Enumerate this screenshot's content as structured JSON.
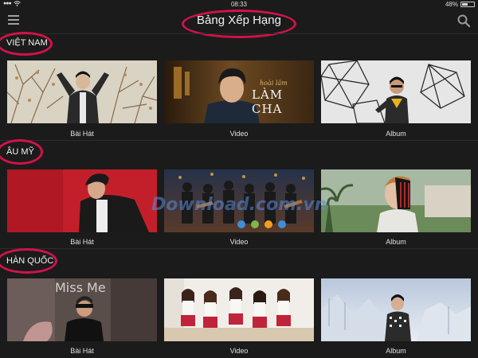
{
  "status": {
    "time": "08:33",
    "battery": "48%"
  },
  "header": {
    "title": "Bảng Xếp Hạng"
  },
  "sections": [
    {
      "label": "VIỆT NAM",
      "items": [
        {
          "caption": "Bài Hát"
        },
        {
          "caption": "Video"
        },
        {
          "caption": "Album"
        }
      ]
    },
    {
      "label": "ÂU MỸ",
      "items": [
        {
          "caption": "Bài Hát"
        },
        {
          "caption": "Video"
        },
        {
          "caption": "Album"
        }
      ]
    },
    {
      "label": "HÀN QUỐC",
      "items": [
        {
          "caption": "Bài Hát"
        },
        {
          "caption": "Video"
        },
        {
          "caption": "Album"
        }
      ]
    }
  ],
  "thumbnail_text": {
    "vn_video_small": "hoài lâm",
    "vn_video_big": "LÀM CHA",
    "kr_song": "Miss Me"
  },
  "watermark": "Download.com.vn",
  "icons": {
    "menu": "hamburger-menu-icon",
    "search": "search-icon",
    "wifi": "wifi-icon",
    "battery": "battery-icon"
  },
  "accent_color": "#d1124a"
}
